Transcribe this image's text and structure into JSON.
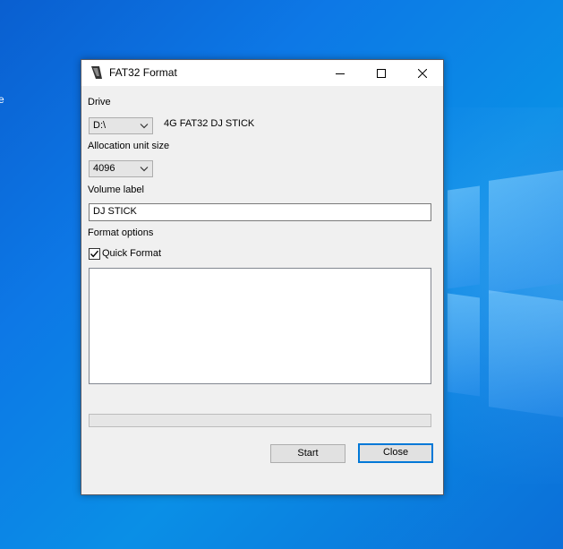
{
  "window": {
    "title": "FAT32 Format",
    "icon": "fat32format-app-icon"
  },
  "titlebar_buttons": {
    "minimize": "minimize-icon",
    "maximize": "maximize-icon",
    "close": "close-icon"
  },
  "desktop": {
    "edge_text": "e"
  },
  "form": {
    "drive_label": "Drive",
    "drive_value": "D:\\",
    "drive_description": "4G FAT32 DJ STICK",
    "allocation_label": "Allocation unit size",
    "allocation_value": "4096",
    "volume_label_label": "Volume label",
    "volume_label_value": "DJ STICK",
    "format_options_label": "Format options",
    "quick_format_label": "Quick Format",
    "quick_format_checked": true,
    "log_text": "",
    "progress_fraction": 0
  },
  "buttons": {
    "start": "Start",
    "close": "Close"
  },
  "colors": {
    "accent": "#0078d7",
    "desktop_blue": "#0d78e6"
  }
}
